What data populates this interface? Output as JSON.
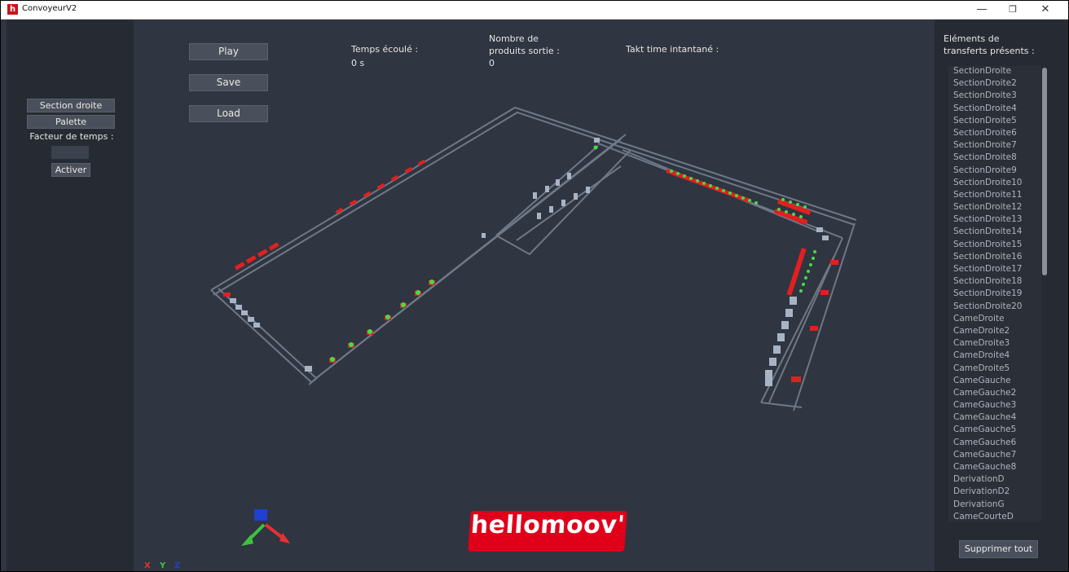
{
  "window": {
    "title": "ConvoyeurV2",
    "app_icon": "h",
    "min_glyph": "—",
    "restore_glyph": "❐",
    "close_glyph": "✕"
  },
  "left_panel": {
    "section_droite": "Section droite",
    "palette": "Palette",
    "time_factor_label": "Facteur de temps :",
    "time_factor_value": "",
    "activate": "Activer"
  },
  "controls": {
    "play": "Play",
    "save": "Save",
    "load": "Load"
  },
  "stats": {
    "elapsed_label": "Temps écoulé :",
    "elapsed_value": "0 s",
    "products_label_1": "Nombre de",
    "products_label_2": "produits sortie :",
    "products_value": "0",
    "takt_label": "Takt time intantané :",
    "takt_value": ""
  },
  "right_panel": {
    "header_1": "Eléments de",
    "header_2": "transferts présents :",
    "items": [
      "SectionDroite",
      "SectionDroite2",
      "SectionDroite3",
      "SectionDroite4",
      "SectionDroite5",
      "SectionDroite6",
      "SectionDroite7",
      "SectionDroite8",
      "SectionDroite9",
      "SectionDroite10",
      "SectionDroite11",
      "SectionDroite12",
      "SectionDroite13",
      "SectionDroite14",
      "SectionDroite15",
      "SectionDroite16",
      "SectionDroite17",
      "SectionDroite18",
      "SectionDroite19",
      "SectionDroite20",
      "CameDroite",
      "CameDroite2",
      "CameDroite3",
      "CameDroite4",
      "CameDroite5",
      "CameGauche",
      "CameGauche2",
      "CameGauche3",
      "CameGauche4",
      "CameGauche5",
      "CameGauche6",
      "CameGauche7",
      "CameGauche8",
      "DerivationD",
      "DerivationD2",
      "DerivationG",
      "CameCourteD"
    ],
    "delete_all": "Supprimer tout"
  },
  "axes": {
    "x": "X",
    "y": "Y",
    "z": "Z"
  },
  "colors": {
    "axis_x": "#e53030",
    "axis_y": "#3cc43c",
    "axis_z": "#2040d0",
    "accent": "#e1001a",
    "pallet_red": "#e02020",
    "product_green": "#44dd44"
  },
  "logo": {
    "text": "hellomoov'"
  }
}
